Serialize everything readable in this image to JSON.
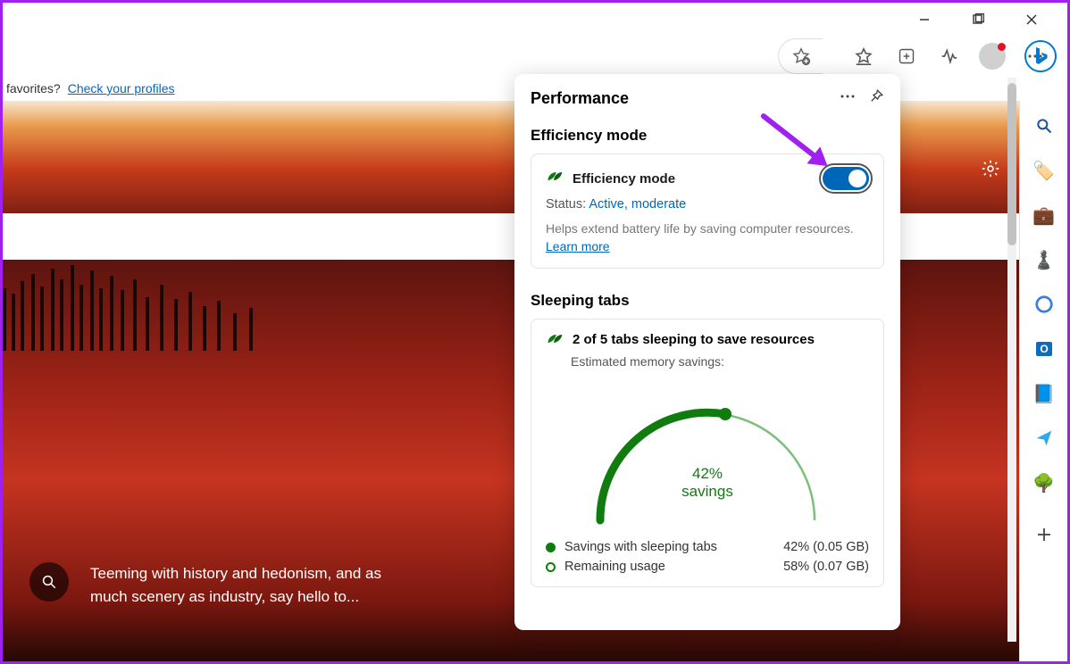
{
  "titlebar": {
    "minimize": "—",
    "maximize": "❐",
    "close": "✕"
  },
  "favbar": {
    "prefix": "favorites?",
    "link": "Check your profiles"
  },
  "caption": "Teeming with history and hedonism, and as much scenery as industry, say hello to...",
  "panel": {
    "title": "Performance",
    "efficiency": {
      "section": "Efficiency mode",
      "label": "Efficiency mode",
      "status_prefix": "Status:",
      "status_value": "Active, moderate",
      "help": "Helps extend battery life by saving computer resources.",
      "learn": "Learn more"
    },
    "sleeping": {
      "section": "Sleeping tabs",
      "headline": "2 of 5 tabs sleeping to save resources",
      "subline": "Estimated memory savings:",
      "gauge_line1": "42%",
      "gauge_line2": "savings",
      "legend1_label": "Savings with sleeping tabs",
      "legend1_value": "42% (0.05 GB)",
      "legend2_label": "Remaining usage",
      "legend2_value": "58% (0.07 GB)"
    }
  }
}
